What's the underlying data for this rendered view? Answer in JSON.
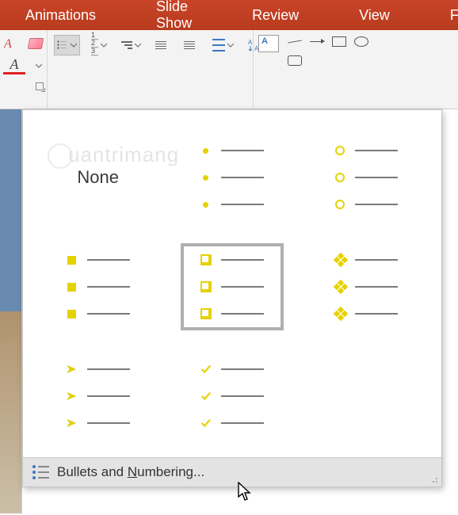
{
  "ribbon": {
    "tabs": {
      "animations": "Animations",
      "slideshow": "Slide Show",
      "review": "Review",
      "view": "View",
      "format": "For"
    }
  },
  "bullet_dropdown": {
    "none_label": "None",
    "options": [
      {
        "id": "none",
        "marker": "none",
        "selected": false
      },
      {
        "id": "dot",
        "marker": "dot",
        "selected": false
      },
      {
        "id": "circle",
        "marker": "circle",
        "selected": false
      },
      {
        "id": "square",
        "marker": "square",
        "selected": false
      },
      {
        "id": "box-square",
        "marker": "boxsq",
        "selected": true
      },
      {
        "id": "four-diam",
        "marker": "4diamond",
        "selected": false
      },
      {
        "id": "arrow",
        "marker": "arrow",
        "selected": false
      },
      {
        "id": "check",
        "marker": "check",
        "selected": false
      }
    ],
    "footer_label_pre": "Bullets and ",
    "footer_label_ul": "N",
    "footer_label_post": "umbering..."
  },
  "watermark": "uantrimang",
  "colors": {
    "bullet_accent": "#e5d200",
    "ribbon_bg": "#b83b1d"
  }
}
